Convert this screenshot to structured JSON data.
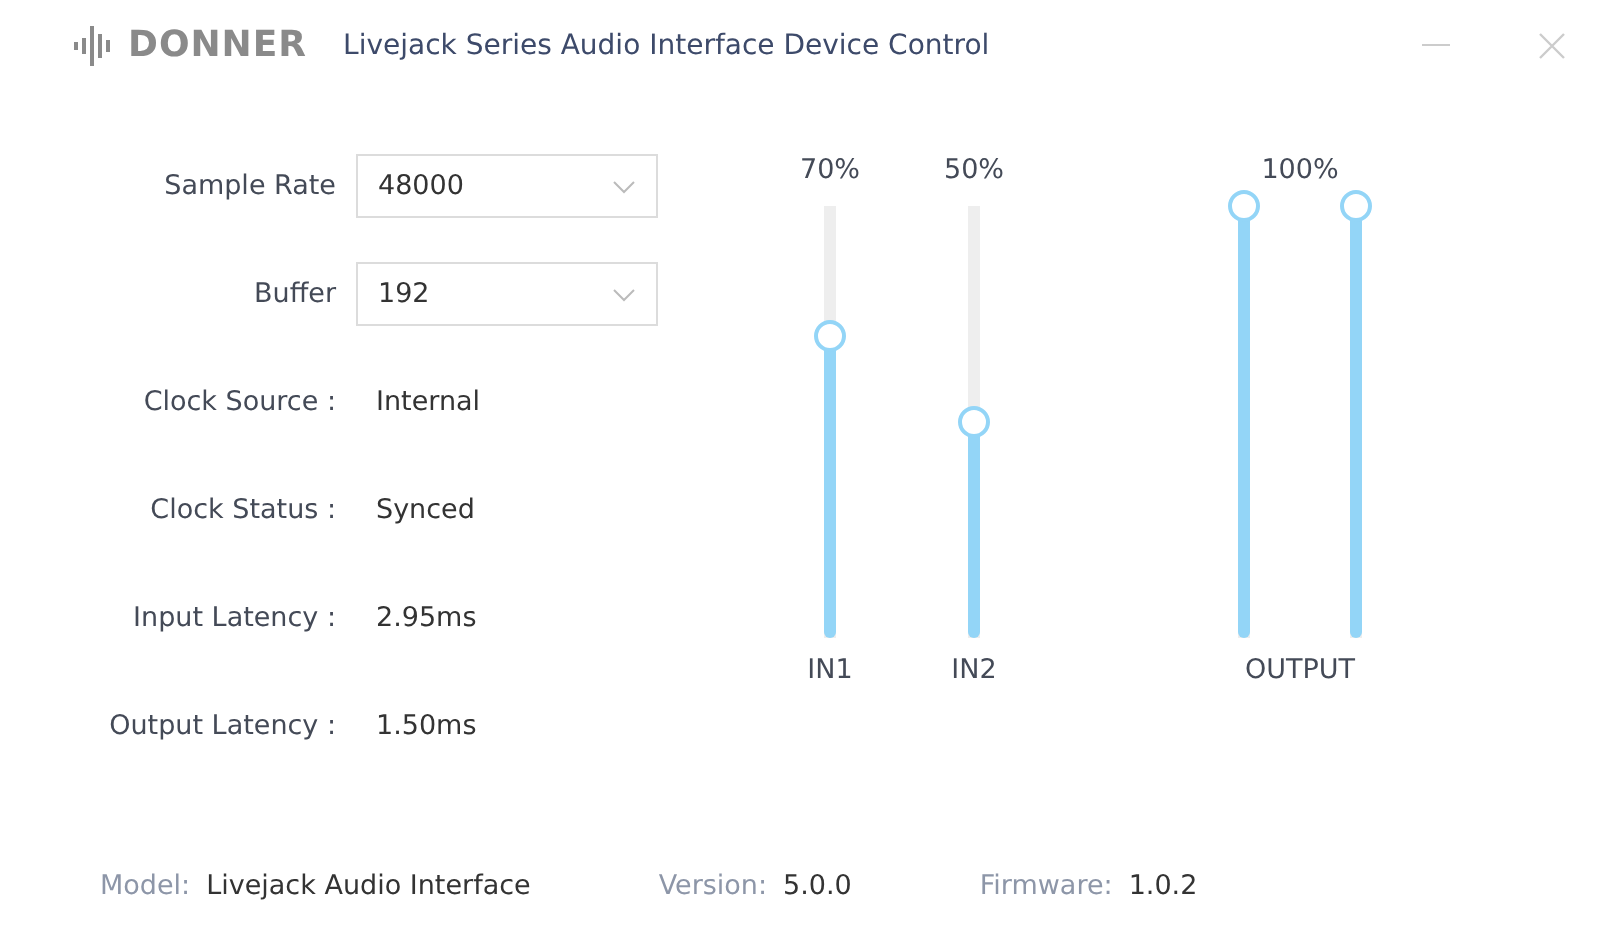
{
  "window": {
    "brand": "DONNER",
    "title": "Livejack Series Audio Interface Device Control"
  },
  "settings": [
    {
      "kind": "select",
      "label": "Sample Rate",
      "value": "48000"
    },
    {
      "kind": "select",
      "label": "Buffer",
      "value": "192"
    },
    {
      "kind": "info",
      "label": "Clock Source :",
      "value": "Internal"
    },
    {
      "kind": "info",
      "label": "Clock Status :",
      "value": "Synced"
    },
    {
      "kind": "info",
      "label": "Input Latency :",
      "value": "2.95ms"
    },
    {
      "kind": "info",
      "label": "Output Latency :",
      "value": "1.50ms"
    }
  ],
  "mixer": [
    {
      "reading": "70%",
      "label": "IN1",
      "channels": [
        {
          "level": 0.7
        }
      ]
    },
    {
      "reading": "50%",
      "label": "IN2",
      "channels": [
        {
          "level": 0.5
        }
      ]
    },
    {
      "reading": "100%",
      "label": "OUTPUT",
      "channels": [
        {
          "level": 1
        },
        {
          "level": 1
        }
      ]
    }
  ],
  "footer": [
    {
      "label": "Model:",
      "value": "Livejack Audio Interface"
    },
    {
      "label": "Version:",
      "value": "5.0.0"
    },
    {
      "label": "Firmware:",
      "value": "1.0.2"
    }
  ]
}
